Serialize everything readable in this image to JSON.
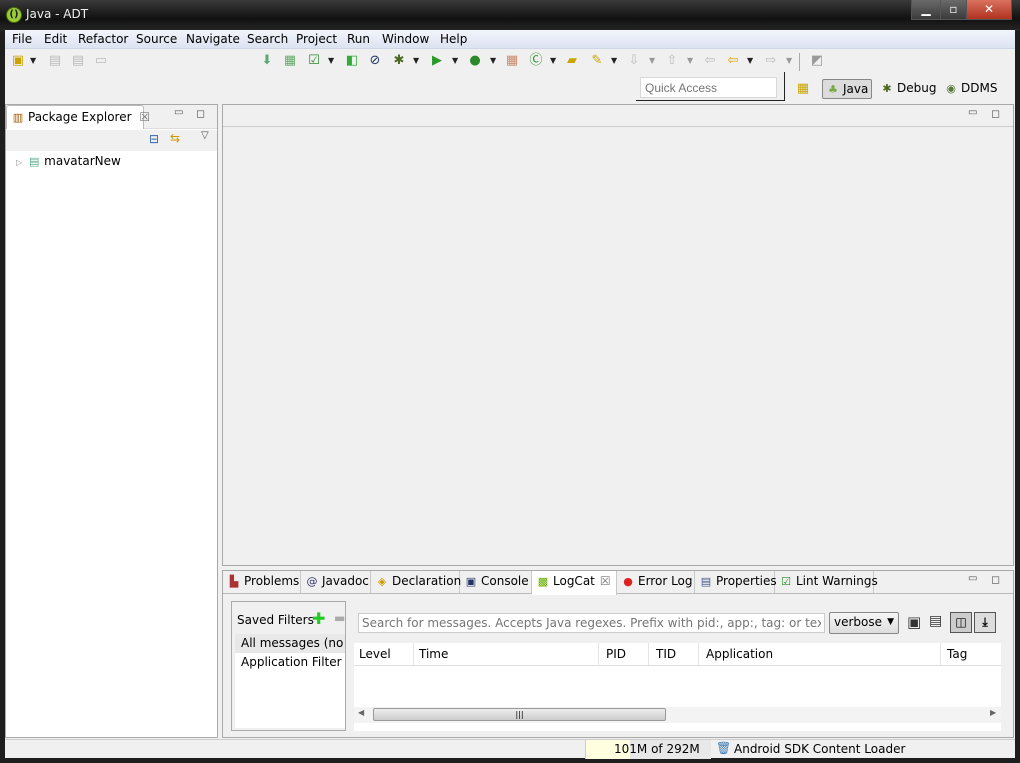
{
  "window": {
    "title": "Java - ADT",
    "controls": [
      "minimize",
      "maximize",
      "close"
    ]
  },
  "menu": [
    "File",
    "Edit",
    "Refactor",
    "Source",
    "Navigate",
    "Search",
    "Project",
    "Run",
    "Window",
    "Help"
  ],
  "toolbar": {
    "icons": [
      "new-wizard-icon",
      "save-icon",
      "save-all-icon",
      "print-icon",
      "android-sdk-manager-icon",
      "android-avd-manager-icon",
      "lint-check-icon",
      "new-android-project-icon",
      "ndk-icon",
      "debug-icon",
      "run-icon",
      "external-tools-icon",
      "new-package-icon",
      "new-class-icon",
      "open-type-icon",
      "search-icon",
      "next-annotation-icon",
      "previous-annotation-icon",
      "last-edit-icon",
      "back-icon",
      "forward-icon",
      "pin-editor-icon"
    ]
  },
  "quick_access": {
    "placeholder": "Quick Access"
  },
  "perspectives": [
    {
      "label": "Java",
      "active": true
    },
    {
      "label": "Debug"
    },
    {
      "label": "DDMS"
    }
  ],
  "package_explorer": {
    "title": "Package Explorer",
    "items": [
      {
        "label": "mavatarNew"
      }
    ]
  },
  "bottom_tabs": [
    {
      "label": "Problems"
    },
    {
      "label": "Javadoc",
      "icon": "@"
    },
    {
      "label": "Declaration"
    },
    {
      "label": "Console"
    },
    {
      "label": "LogCat",
      "active": true
    },
    {
      "label": "Error Log"
    },
    {
      "label": "Properties"
    },
    {
      "label": "Lint Warnings"
    }
  ],
  "logcat": {
    "saved_filters_label": "Saved Filters",
    "filters": [
      "All messages (no fi",
      "Application Filter"
    ],
    "search_placeholder": "Search for messages. Accepts Java regexes. Prefix with pid:, app:, tag: or text: to limit scope.",
    "level": "verbose",
    "columns": [
      "Level",
      "Time",
      "PID",
      "TID",
      "Application",
      "Tag"
    ]
  },
  "status": {
    "heap": "101M of 292M",
    "heap_fraction": 0.35,
    "task": "Android SDK Content Loader"
  }
}
